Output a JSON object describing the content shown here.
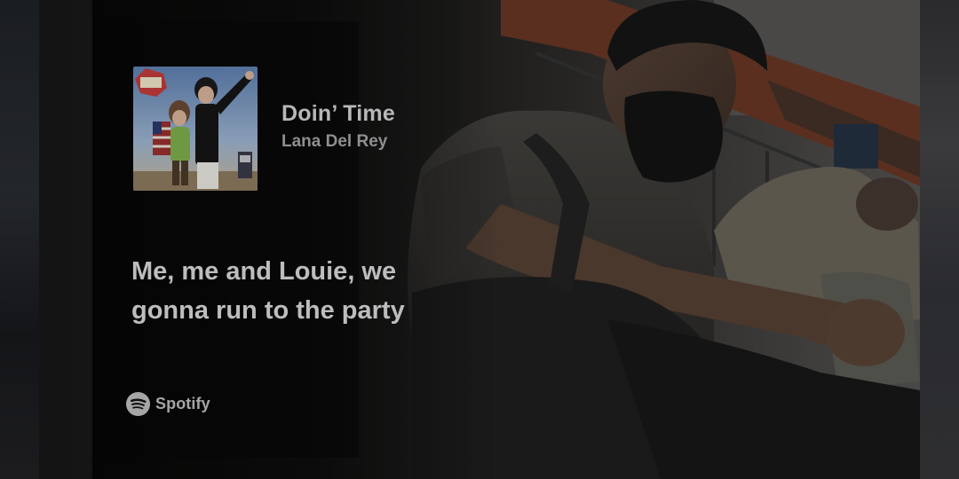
{
  "track": {
    "title": "Doin’ Time",
    "artist": "Lana Del Rey"
  },
  "lyrics": {
    "lines": [
      "Me, me and Louie, we",
      "gonna run to the party"
    ]
  },
  "brand": {
    "label": "Spotify",
    "icon": "spotify-logo-icon"
  },
  "colors": {
    "background": "#0a0a0a",
    "title_text": "#b8b8b8",
    "artist_text": "#8f8f8f",
    "lyrics_text": "#bdbdbd"
  }
}
